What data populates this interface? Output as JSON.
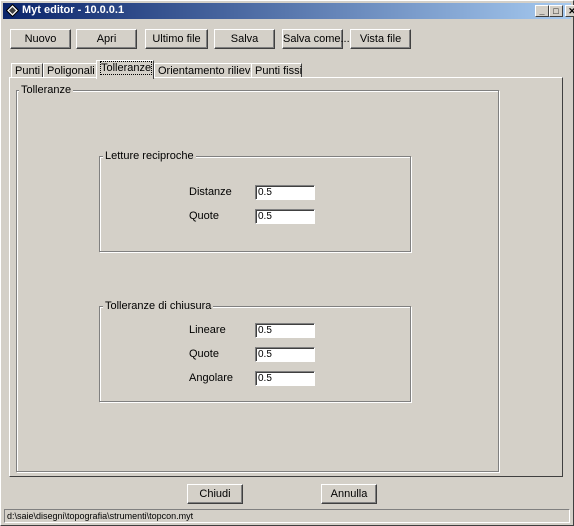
{
  "window": {
    "title": "Myt editor - 10.0.0.1"
  },
  "title_buttons": {
    "minimize": "_",
    "maximize": "□",
    "close": "✕"
  },
  "toolbar": {
    "new_label": "Nuovo",
    "open_label": "Apri",
    "last_file_label": "Ultimo file",
    "save_label": "Salva",
    "save_as_label": "Salva come...",
    "view_file_label": "Vista file"
  },
  "tabs": [
    {
      "label": "Punti"
    },
    {
      "label": "Poligonali"
    },
    {
      "label": "Tolleranze",
      "active": true
    },
    {
      "label": "Orientamento rilievo"
    },
    {
      "label": "Punti fissi"
    }
  ],
  "panel": {
    "title": "Tolleranze",
    "letture_reciproche": {
      "title": "Letture reciproche",
      "distanze_label": "Distanze",
      "distanze_value": "0.5",
      "quote_label": "Quote",
      "quote_value": "0.5"
    },
    "chiusura": {
      "title": "Tolleranze di chiusura",
      "lineare_label": "Lineare",
      "lineare_value": "0.5",
      "quote_label": "Quote",
      "quote_value": "0.5",
      "angolare_label": "Angolare",
      "angolare_value": "0.5"
    }
  },
  "footer": {
    "close_label": "Chiudi",
    "cancel_label": "Annulla"
  },
  "status": {
    "path": "d:\\saie\\disegni\\topografia\\strumenti\\topcon.myt"
  },
  "icons": {
    "app": "app-diamond-icon"
  }
}
